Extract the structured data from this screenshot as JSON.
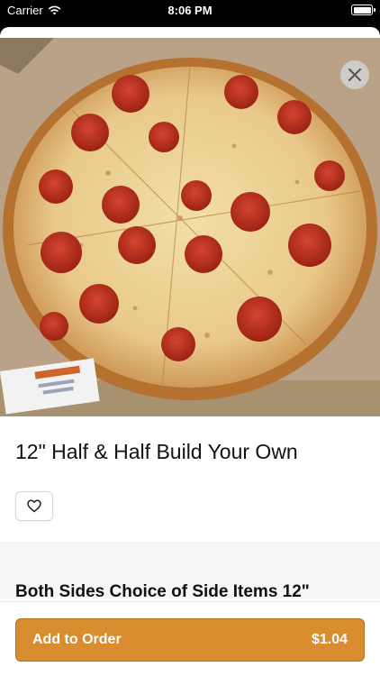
{
  "status_bar": {
    "carrier": "Carrier",
    "time": "8:06 PM"
  },
  "item": {
    "title": "12\" Half & Half Build Your Own",
    "image_alt": "pepperoni-pizza-photo"
  },
  "section": {
    "title": "Both Sides Choice of Side Items 12\""
  },
  "footer": {
    "add_label": "Add to Order",
    "price": "$1.04"
  },
  "colors": {
    "accent": "#d98d2f",
    "accent_border": "#b87422"
  },
  "icons": {
    "close": "close-icon",
    "favorite": "heart-icon",
    "wifi": "wifi-icon",
    "battery": "battery-icon"
  }
}
